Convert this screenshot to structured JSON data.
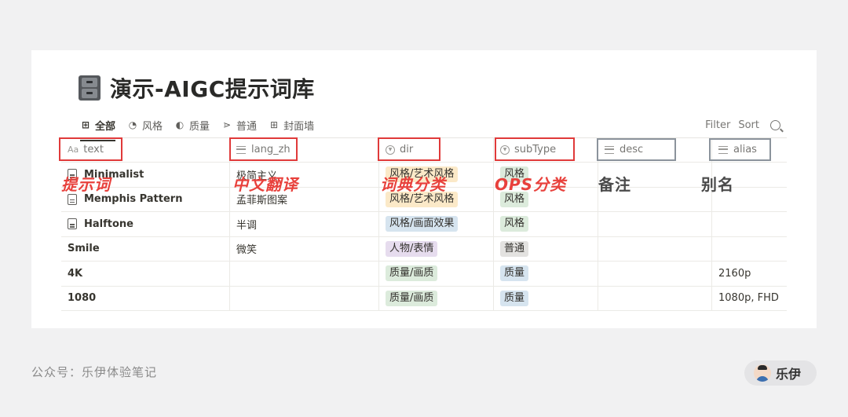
{
  "page": {
    "title": "演示-AIGC提示词库",
    "title_icon": "file-cabinet-icon"
  },
  "views": [
    {
      "label": "全部",
      "icon": "table-icon",
      "glyph": "⊞",
      "active": true
    },
    {
      "label": "风格",
      "icon": "palette-icon",
      "glyph": "◔",
      "active": false
    },
    {
      "label": "质量",
      "icon": "contrast-icon",
      "glyph": "◐",
      "active": false
    },
    {
      "label": "普通",
      "icon": "fish-icon",
      "glyph": "⋗",
      "active": false
    },
    {
      "label": "封面墙",
      "icon": "gallery-icon",
      "glyph": "⊞",
      "active": false
    }
  ],
  "toolbar": {
    "filter": "Filter",
    "sort": "Sort",
    "search_icon": "search-icon"
  },
  "columns": [
    {
      "key": "text",
      "label": "text",
      "icon": "Aa"
    },
    {
      "key": "lang_zh",
      "label": "lang_zh",
      "icon": "lines"
    },
    {
      "key": "dir",
      "label": "dir",
      "icon": "select"
    },
    {
      "key": "subType",
      "label": "subType",
      "icon": "select"
    },
    {
      "key": "desc",
      "label": "desc",
      "icon": "lines"
    },
    {
      "key": "alias",
      "label": "alias",
      "icon": "lines"
    }
  ],
  "rows": [
    {
      "text": "Minimalist",
      "doc": true,
      "lang_zh": "极简主义",
      "dir": "风格/艺术风格",
      "subType": "风格",
      "desc": "",
      "alias": ""
    },
    {
      "text": "Memphis Pattern",
      "doc": true,
      "lang_zh": "孟菲斯图案",
      "dir": "风格/艺术风格",
      "subType": "风格",
      "desc": "",
      "alias": ""
    },
    {
      "text": "Halftone",
      "doc": true,
      "lang_zh": "半调",
      "dir": "风格/画面效果",
      "subType": "风格",
      "desc": "",
      "alias": ""
    },
    {
      "text": "Smile",
      "doc": false,
      "lang_zh": "微笑",
      "dir": "人物/表情",
      "subType": "普通",
      "desc": "",
      "alias": ""
    },
    {
      "text": "4K",
      "doc": false,
      "lang_zh": "",
      "dir": "质量/画质",
      "subType": "质量",
      "desc": "",
      "alias": "2160p"
    },
    {
      "text": "1080",
      "doc": false,
      "lang_zh": "",
      "dir": "质量/画质",
      "subType": "质量",
      "desc": "",
      "alias": "1080p, FHD"
    }
  ],
  "tag_colors": {
    "风格/艺术风格": "#fbe9c8",
    "风格/画面效果": "#d6e4ef",
    "人物/表情": "#e6dcee",
    "质量/画质": "#dcebdc",
    "风格": "#dcebdc",
    "普通": "#e3e2e0",
    "质量": "#d6e4ef"
  },
  "annotations": {
    "text": "提示词",
    "lang_zh": "中文翻译",
    "dir": "词典分类",
    "subType": "OPS分类",
    "desc": "备注",
    "alias": "别名"
  },
  "footer": {
    "left": "公众号：乐伊体验笔记",
    "badge": "乐伊"
  }
}
